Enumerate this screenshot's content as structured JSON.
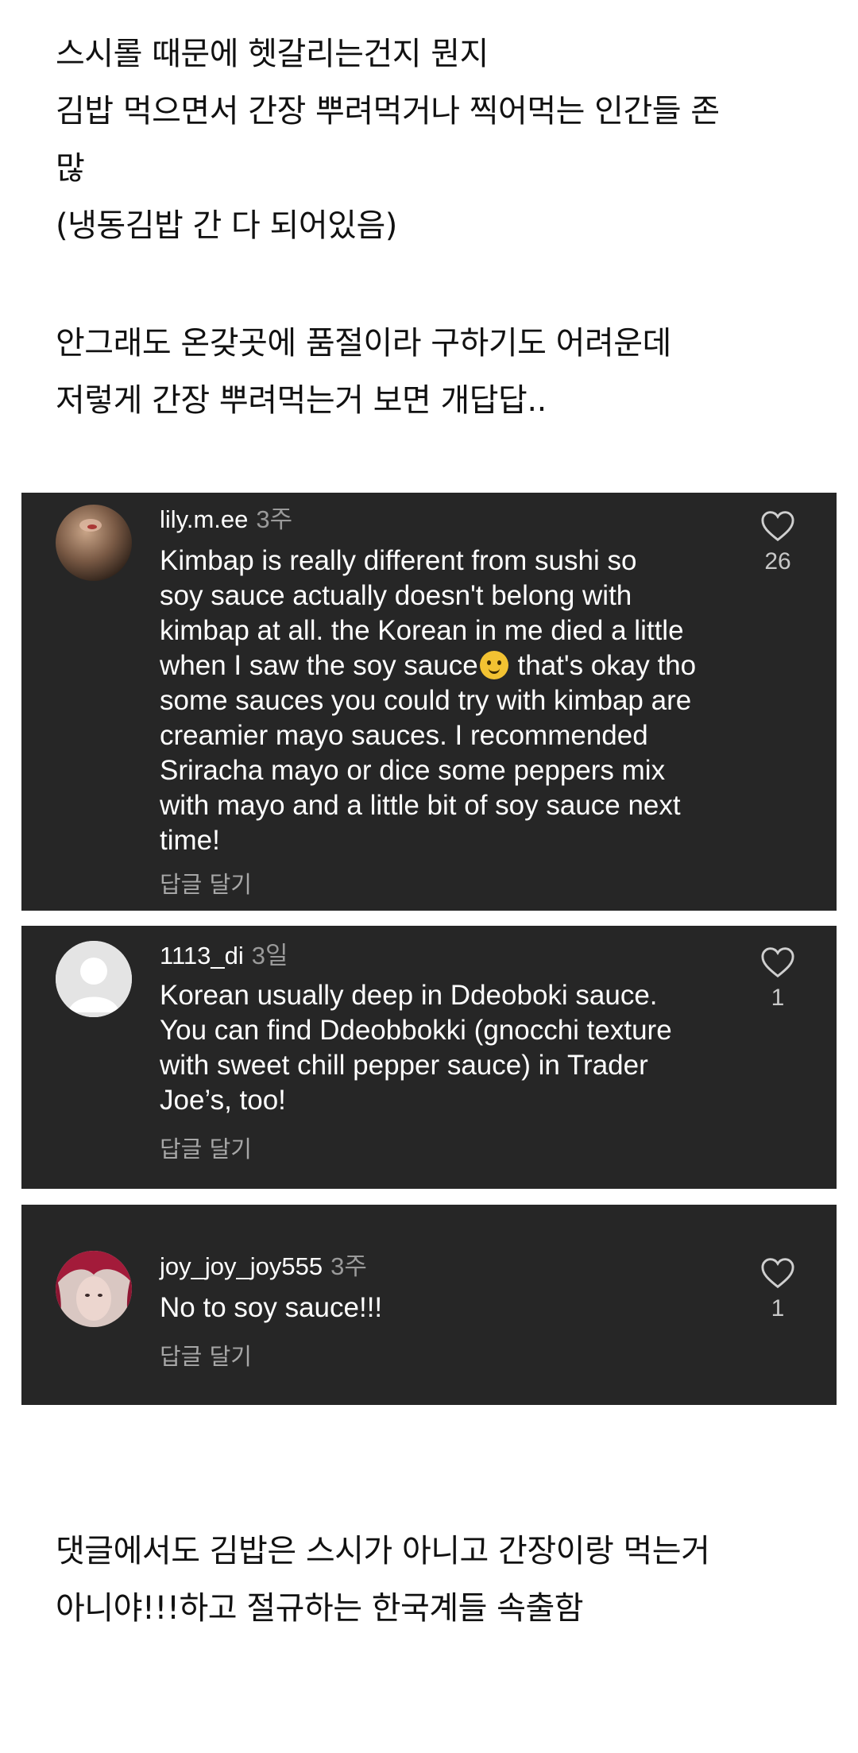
{
  "post": {
    "intro_lines": [
      "스시롤 때문에 헷갈리는건지 뭔지",
      "김밥 먹으면서 간장 뿌려먹거나 찍어먹는 인간들 존",
      "많",
      "(냉동김밥 간 다 되어있음)"
    ],
    "intro2_lines": [
      "안그래도 온갖곳에 품절이라 구하기도 어려운데",
      "저렇게 간장 뿌려먹는거 보면 개답답.."
    ],
    "outro_lines": [
      "댓글에서도 김밥은 스시가 아니고 간장이랑 먹는거",
      "아니야!!!하고 절규하는 한국계들 속출함"
    ]
  },
  "comments": [
    {
      "username": "lily.m.ee",
      "time": "3주",
      "lines": [
        "Kimbap is really different from sushi so",
        "soy sauce actually doesn't belong with",
        "kimbap at all. the Korean in me died a little",
        "when I saw the soy sauce",
        "some sauces you could try with kimbap are",
        "creamier mayo sauces. I recommended",
        "Sriracha mayo or dice some peppers mix",
        "with mayo and a little bit of soy sauce next",
        "time!"
      ],
      "line4_tail": " that's okay tho",
      "reply_label": "답글 달기",
      "likes": "26"
    },
    {
      "username": "1113_di",
      "time": "3일",
      "lines": [
        "Korean usually deep in Ddeoboki sauce.",
        "You can find Ddeobbokki (gnocchi texture",
        "with sweet chill pepper sauce) in Trader",
        "Joe’s, too!"
      ],
      "reply_label": "답글 달기",
      "likes": "1"
    },
    {
      "username": "joy_joy_joy555",
      "time": "3주",
      "lines": [
        "No to soy sauce!!!"
      ],
      "reply_label": "답글 달기",
      "likes": "1"
    }
  ],
  "colors": {
    "card_bg": "#262626",
    "muted_text": "#a7a7a7",
    "page_bg": "#ffffff"
  }
}
